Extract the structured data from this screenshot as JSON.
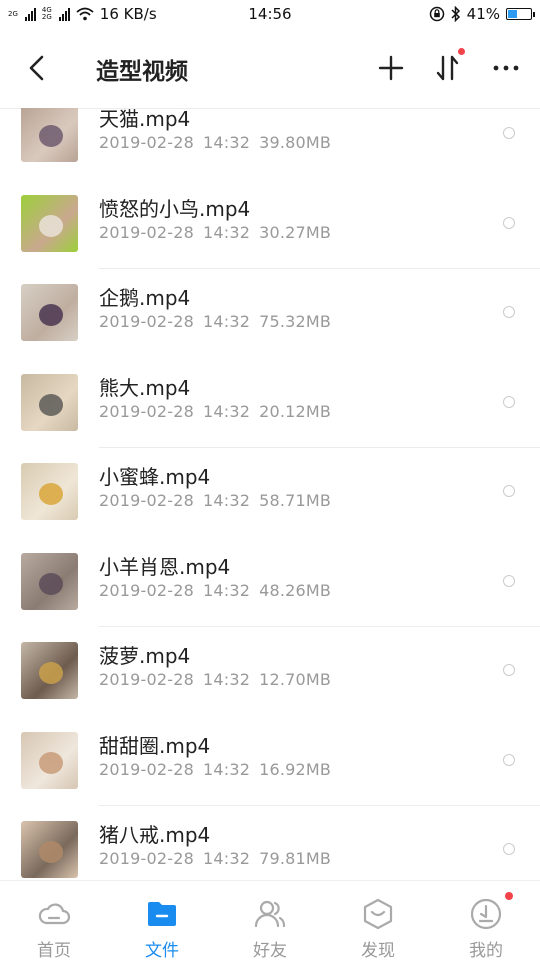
{
  "status_bar": {
    "net_label_top": "2G",
    "net_label_2g": "4G",
    "net_label_2": "2G",
    "speed": "16 KB/s",
    "time": "14:56",
    "battery": "41%",
    "battery_level": 0.41,
    "battery_color": "#2b9cf2"
  },
  "header": {
    "title": "造型视频",
    "icons": [
      "back-icon",
      "plus-icon",
      "sort-icon",
      "more-icon"
    ]
  },
  "files": [
    {
      "name": "天猫.mp4",
      "date": "2019-02-28",
      "time": "14:32",
      "size": "39.80MB"
    },
    {
      "name": "愤怒的小鸟.mp4",
      "date": "2019-02-28",
      "time": "14:32",
      "size": "30.27MB"
    },
    {
      "name": "企鹅.mp4",
      "date": "2019-02-28",
      "time": "14:32",
      "size": "75.32MB"
    },
    {
      "name": "熊大.mp4",
      "date": "2019-02-28",
      "time": "14:32",
      "size": "20.12MB"
    },
    {
      "name": "小蜜蜂.mp4",
      "date": "2019-02-28",
      "time": "14:32",
      "size": "58.71MB"
    },
    {
      "name": "小羊肖恩.mp4",
      "date": "2019-02-28",
      "time": "14:32",
      "size": "48.26MB"
    },
    {
      "name": "菠萝.mp4",
      "date": "2019-02-28",
      "time": "14:32",
      "size": "12.70MB"
    },
    {
      "name": "甜甜圈.mp4",
      "date": "2019-02-28",
      "time": "14:32",
      "size": "16.92MB"
    },
    {
      "name": "猪八戒.mp4",
      "date": "2019-02-28",
      "time": "14:32",
      "size": "79.81MB"
    }
  ],
  "nav": {
    "tabs": [
      {
        "label": "首页",
        "icon": "cloud-icon"
      },
      {
        "label": "文件",
        "icon": "folder-icon",
        "active": true
      },
      {
        "label": "好友",
        "icon": "friends-icon"
      },
      {
        "label": "发现",
        "icon": "discover-icon"
      },
      {
        "label": "我的",
        "icon": "profile-icon"
      }
    ],
    "active_color": "#1a8cf0",
    "badge_color": "#f2424a"
  }
}
